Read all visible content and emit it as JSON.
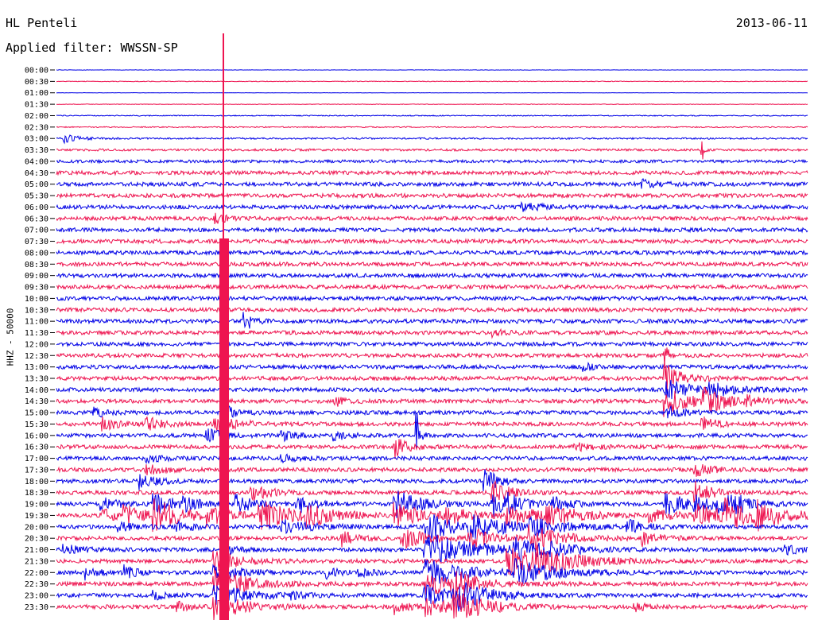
{
  "header": {
    "station": "HL Penteli",
    "filter_label": "Applied filter:",
    "filter_value": "WWSSN-SP",
    "date": "2013-06-11"
  },
  "chart_data": {
    "type": "line",
    "ylabel": "HHZ - 50000",
    "colors": [
      "#0000e6",
      "#ee1450"
    ],
    "traces": [
      {
        "time": "00:00",
        "noise": 0.2,
        "events": []
      },
      {
        "time": "00:30",
        "noise": 0.4,
        "events": []
      },
      {
        "time": "01:00",
        "noise": 0.2,
        "events": []
      },
      {
        "time": "01:30",
        "noise": 0.3,
        "events": []
      },
      {
        "time": "02:00",
        "noise": 0.6,
        "events": []
      },
      {
        "time": "02:30",
        "noise": 0.7,
        "events": []
      },
      {
        "time": "03:00",
        "noise": 1.0,
        "events": [
          [
            0.01,
            5,
            0.02
          ]
        ]
      },
      {
        "time": "03:30",
        "noise": 1.4,
        "events": [
          [
            0.86,
            12,
            0.003
          ]
        ]
      },
      {
        "time": "04:00",
        "noise": 1.8,
        "events": []
      },
      {
        "time": "04:30",
        "noise": 2.4,
        "events": []
      },
      {
        "time": "05:00",
        "noise": 2.5,
        "events": [
          [
            0.78,
            5,
            0.02
          ]
        ]
      },
      {
        "time": "05:30",
        "noise": 2.5,
        "events": []
      },
      {
        "time": "06:00",
        "noise": 2.5,
        "events": [
          [
            0.62,
            4,
            0.03
          ]
        ]
      },
      {
        "time": "06:30",
        "noise": 2.5,
        "events": [
          [
            0.21,
            6,
            0.015
          ]
        ]
      },
      {
        "time": "07:00",
        "noise": 2.5,
        "events": []
      },
      {
        "time": "07:30",
        "noise": 2.5,
        "events": []
      },
      {
        "time": "08:00",
        "noise": 2.5,
        "events": []
      },
      {
        "time": "08:30",
        "noise": 2.5,
        "events": []
      },
      {
        "time": "09:00",
        "noise": 2.5,
        "events": []
      },
      {
        "time": "09:30",
        "noise": 2.5,
        "events": []
      },
      {
        "time": "10:00",
        "noise": 2.5,
        "events": []
      },
      {
        "time": "10:30",
        "noise": 2.5,
        "events": []
      },
      {
        "time": "11:00",
        "noise": 2.5,
        "events": [
          [
            0.25,
            14,
            0.01
          ]
        ]
      },
      {
        "time": "11:30",
        "noise": 2.5,
        "events": [
          [
            0.58,
            4,
            0.02
          ]
        ]
      },
      {
        "time": "12:00",
        "noise": 2.5,
        "events": []
      },
      {
        "time": "12:30",
        "noise": 2.5,
        "events": [
          [
            0.81,
            18,
            0.004
          ]
        ]
      },
      {
        "time": "13:00",
        "noise": 2.5,
        "events": [
          [
            0.7,
            6,
            0.01
          ]
        ]
      },
      {
        "time": "13:30",
        "noise": 2.5,
        "events": [
          [
            0.81,
            20,
            0.02
          ]
        ]
      },
      {
        "time": "14:00",
        "noise": 2.5,
        "events": [
          [
            0.81,
            14,
            0.03
          ],
          [
            0.87,
            8,
            0.03
          ]
        ]
      },
      {
        "time": "14:30",
        "noise": 2.5,
        "events": [
          [
            0.81,
            18,
            0.03
          ],
          [
            0.86,
            14,
            0.03
          ],
          [
            0.37,
            6,
            0.015
          ],
          [
            0.92,
            5,
            0.015
          ]
        ]
      },
      {
        "time": "15:00",
        "noise": 2.5,
        "events": [
          [
            0.05,
            6,
            0.015
          ],
          [
            0.23,
            6,
            0.015
          ],
          [
            0.81,
            8,
            0.02
          ]
        ]
      },
      {
        "time": "15:30",
        "noise": 2.5,
        "events": [
          [
            0.06,
            8,
            0.02
          ],
          [
            0.12,
            8,
            0.02
          ],
          [
            0.21,
            10,
            0.03
          ],
          [
            0.86,
            8,
            0.02
          ]
        ]
      },
      {
        "time": "16:00",
        "noise": 2.5,
        "events": [
          [
            0.2,
            8,
            0.02
          ],
          [
            0.3,
            6,
            0.015
          ],
          [
            0.37,
            6,
            0.015
          ],
          [
            0.48,
            30,
            0.004
          ]
        ]
      },
      {
        "time": "16:30",
        "noise": 2.5,
        "events": [
          [
            0.45,
            14,
            0.015
          ],
          [
            0.69,
            5,
            0.02
          ]
        ]
      },
      {
        "time": "17:00",
        "noise": 2.5,
        "events": [
          [
            0.12,
            4,
            0.02
          ],
          [
            0.3,
            4,
            0.02
          ]
        ]
      },
      {
        "time": "17:30",
        "noise": 2.5,
        "events": [
          [
            0.12,
            6,
            0.02
          ],
          [
            0.85,
            8,
            0.02
          ]
        ]
      },
      {
        "time": "18:00",
        "noise": 2.5,
        "events": [
          [
            0.11,
            10,
            0.02
          ],
          [
            0.57,
            16,
            0.015
          ]
        ]
      },
      {
        "time": "18:30",
        "noise": 2.5,
        "events": [
          [
            0.26,
            12,
            0.02
          ],
          [
            0.58,
            16,
            0.02
          ],
          [
            0.85,
            14,
            0.02
          ]
        ]
      },
      {
        "time": "19:00",
        "noise": 2.5,
        "events": [
          [
            0.06,
            8,
            0.02
          ],
          [
            0.13,
            14,
            0.025
          ],
          [
            0.17,
            6,
            0.02
          ],
          [
            0.24,
            12,
            0.02
          ],
          [
            0.32,
            12,
            0.02
          ],
          [
            0.45,
            20,
            0.03
          ],
          [
            0.58,
            16,
            0.03
          ],
          [
            0.6,
            6,
            0.02
          ],
          [
            0.66,
            8,
            0.02
          ],
          [
            0.81,
            14,
            0.03
          ],
          [
            0.85,
            10,
            0.02
          ],
          [
            0.88,
            12,
            0.025
          ],
          [
            0.9,
            8,
            0.02
          ]
        ]
      },
      {
        "time": "19:30",
        "noise": 2.5,
        "events": [
          [
            0.06,
            8,
            0.025
          ],
          [
            0.09,
            10,
            0.03
          ],
          [
            0.13,
            18,
            0.035
          ],
          [
            0.2,
            10,
            0.03
          ],
          [
            0.27,
            18,
            0.04
          ],
          [
            0.33,
            12,
            0.04
          ],
          [
            0.45,
            14,
            0.04
          ],
          [
            0.52,
            8,
            0.03
          ],
          [
            0.6,
            12,
            0.04
          ],
          [
            0.65,
            12,
            0.04
          ],
          [
            0.79,
            8,
            0.03
          ],
          [
            0.85,
            14,
            0.04
          ],
          [
            0.89,
            16,
            0.04
          ],
          [
            0.93,
            12,
            0.04
          ]
        ]
      },
      {
        "time": "20:00",
        "noise": 2.5,
        "events": [
          [
            0.08,
            6,
            0.02
          ],
          [
            0.16,
            6,
            0.02
          ],
          [
            0.3,
            8,
            0.04
          ],
          [
            0.49,
            22,
            0.03
          ],
          [
            0.55,
            14,
            0.05
          ],
          [
            0.63,
            10,
            0.04
          ],
          [
            0.76,
            8,
            0.02
          ]
        ]
      },
      {
        "time": "20:30",
        "noise": 2.5,
        "events": [
          [
            0.38,
            10,
            0.015
          ],
          [
            0.46,
            14,
            0.03
          ],
          [
            0.55,
            14,
            0.03
          ],
          [
            0.63,
            16,
            0.04
          ],
          [
            0.78,
            8,
            0.02
          ]
        ]
      },
      {
        "time": "21:00",
        "noise": 2.5,
        "events": [
          [
            0.01,
            6,
            0.02
          ],
          [
            0.22,
            8,
            0.015
          ],
          [
            0.49,
            22,
            0.06
          ],
          [
            0.61,
            12,
            0.04
          ],
          [
            0.64,
            8,
            0.03
          ],
          [
            0.97,
            8,
            0.015
          ]
        ]
      },
      {
        "time": "21:30",
        "noise": 2.5,
        "events": [
          [
            0.21,
            14,
            0.03
          ],
          [
            0.6,
            18,
            0.06
          ],
          [
            0.64,
            10,
            0.04
          ]
        ]
      },
      {
        "time": "22:00",
        "noise": 2.5,
        "events": [
          [
            0.04,
            8,
            0.015
          ],
          [
            0.09,
            8,
            0.015
          ],
          [
            0.21,
            12,
            0.03
          ],
          [
            0.36,
            6,
            0.015
          ],
          [
            0.4,
            6,
            0.015
          ],
          [
            0.49,
            18,
            0.05
          ],
          [
            0.61,
            14,
            0.05
          ]
        ]
      },
      {
        "time": "22:30",
        "noise": 2.5,
        "events": [
          [
            0.21,
            20,
            0.04
          ],
          [
            0.49,
            16,
            0.05
          ],
          [
            0.53,
            14,
            0.02
          ]
        ]
      },
      {
        "time": "23:00",
        "noise": 2.5,
        "events": [
          [
            0.13,
            6,
            0.015
          ],
          [
            0.21,
            14,
            0.04
          ],
          [
            0.31,
            6,
            0.015
          ],
          [
            0.49,
            12,
            0.04
          ],
          [
            0.53,
            16,
            0.04
          ]
        ]
      },
      {
        "time": "23:30",
        "noise": 2.5,
        "events": [
          [
            0.16,
            6,
            0.015
          ],
          [
            0.21,
            16,
            0.04
          ],
          [
            0.45,
            8,
            0.015
          ],
          [
            0.49,
            10,
            0.04
          ],
          [
            0.53,
            16,
            0.04
          ],
          [
            0.77,
            5,
            0.015
          ]
        ]
      }
    ]
  }
}
